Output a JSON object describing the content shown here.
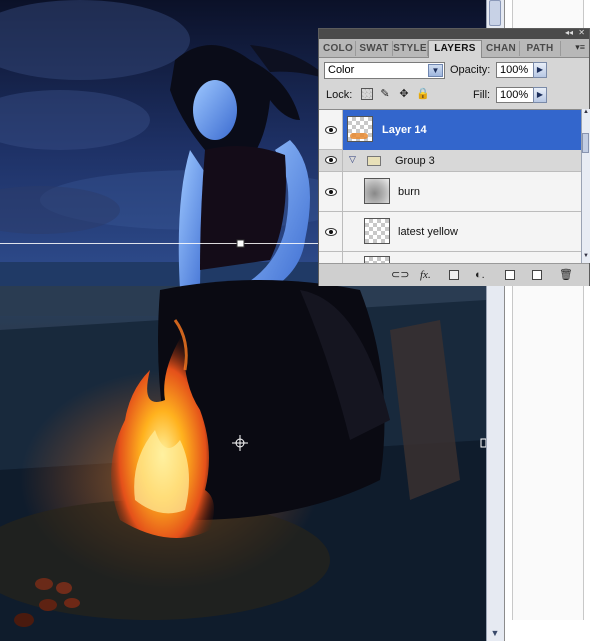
{
  "panel": {
    "tabs": [
      "COLO",
      "SWAT",
      "STYLE",
      "LAYERS",
      "CHAN",
      "PATH"
    ],
    "active_tab": "LAYERS",
    "blend_mode": "Color",
    "opacity_label": "Opacity:",
    "opacity_value": "100%",
    "lock_label": "Lock:",
    "fill_label": "Fill:",
    "fill_value": "100%",
    "layers": [
      {
        "name": "Layer 14",
        "selected": true,
        "visible": true
      },
      {
        "name": "Group 3",
        "type": "group",
        "expanded": true,
        "visible": true
      },
      {
        "name": "burn",
        "visible": true
      },
      {
        "name": "latest yellow",
        "visible": true
      }
    ]
  },
  "icons": {
    "lock": [
      "lock-transparent-icon",
      "lock-paint-icon",
      "lock-move-icon",
      "lock-all-icon"
    ],
    "bottom": [
      "link-icon",
      "fx-icon",
      "mask-icon",
      "adjustment-icon",
      "new-group-icon",
      "new-layer-icon",
      "trash-icon"
    ]
  },
  "colors": {
    "selection": "#3366cc",
    "panel_bg": "#d6d6d6"
  }
}
